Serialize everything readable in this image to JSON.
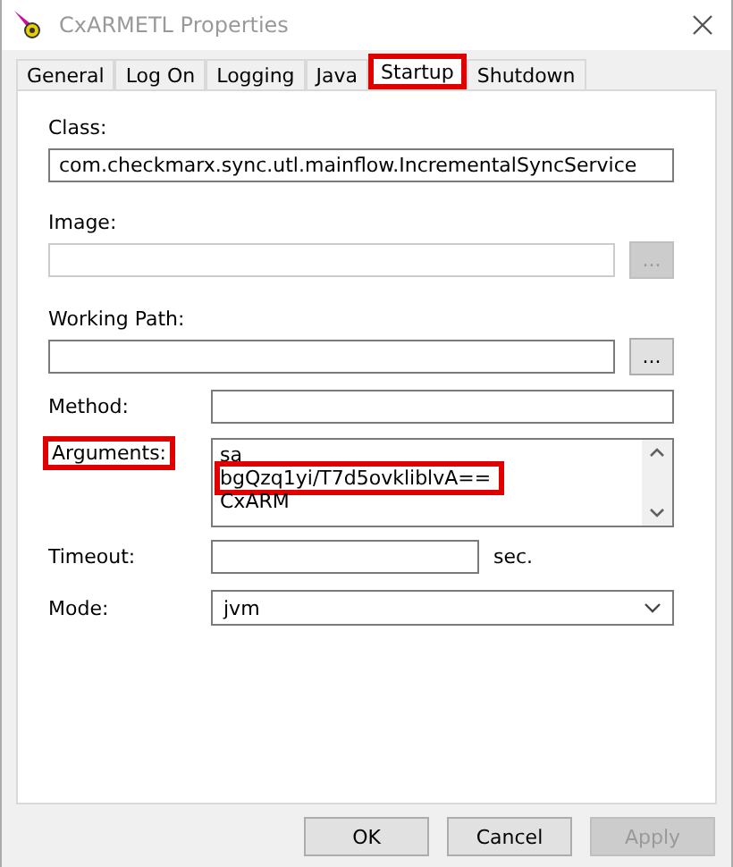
{
  "window": {
    "title": "CxARMETL Properties"
  },
  "tabs": [
    {
      "label": "General",
      "selected": false,
      "highlighted": false
    },
    {
      "label": "Log On",
      "selected": false,
      "highlighted": false
    },
    {
      "label": "Logging",
      "selected": false,
      "highlighted": false
    },
    {
      "label": "Java",
      "selected": false,
      "highlighted": false
    },
    {
      "label": "Startup",
      "selected": true,
      "highlighted": true
    },
    {
      "label": "Shutdown",
      "selected": false,
      "highlighted": false
    }
  ],
  "class": {
    "label": "Class:",
    "value": "com.checkmarx.sync.utl.mainflow.IncrementalSyncService"
  },
  "image": {
    "label": "Image:",
    "disabled": true,
    "browse": "..."
  },
  "working_path": {
    "label": "Working Path:",
    "disabled": false,
    "browse": "..."
  },
  "method": {
    "label": "Method:"
  },
  "arguments": {
    "label": "Arguments:",
    "highlighted": true,
    "lines": [
      {
        "text": "sa",
        "highlighted": false
      },
      {
        "text": "bgQzq1yi/T7d5ovkliblvA==",
        "highlighted": true
      },
      {
        "text": "CxARM",
        "highlighted": false
      }
    ]
  },
  "timeout": {
    "label": "Timeout:",
    "unit": "sec."
  },
  "mode": {
    "label": "Mode:",
    "value": "jvm"
  },
  "buttons": [
    {
      "label": "OK",
      "disabled": false
    },
    {
      "label": "Cancel",
      "disabled": false
    },
    {
      "label": "Apply",
      "disabled": true
    }
  ]
}
